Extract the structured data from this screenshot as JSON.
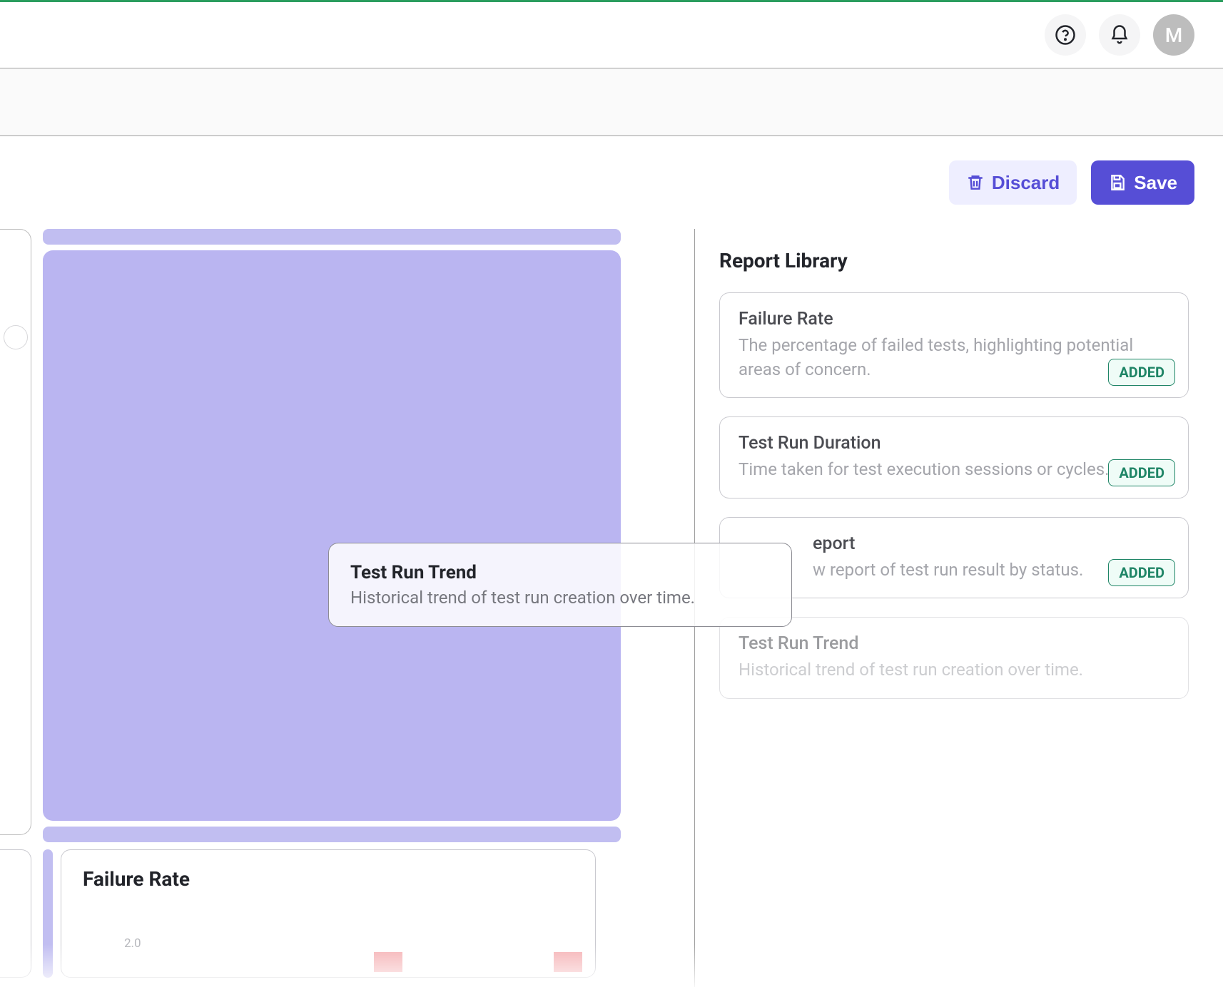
{
  "header": {
    "avatar_initial": "M"
  },
  "actions": {
    "discard_label": "Discard",
    "save_label": "Save"
  },
  "dragging": {
    "title": "Test Run Trend",
    "description": "Historical trend of test run creation over time."
  },
  "failure_card": {
    "title": "Failure Rate",
    "y_tick": "2.0"
  },
  "library": {
    "title": "Report Library",
    "added_label": "ADDED",
    "items": [
      {
        "title": "Failure Rate",
        "description": "The percentage of failed tests, highlighting potential areas of concern.",
        "added": true
      },
      {
        "title": "Test Run Duration",
        "description": "Time taken for test execution sessions or cycles.",
        "added": true
      },
      {
        "title": "eport",
        "description": "w report of test run result by status.",
        "added": true
      },
      {
        "title": "Test Run Trend",
        "description": "Historical trend of test run creation over time.",
        "added": false
      }
    ]
  },
  "chart_data": {
    "type": "bar",
    "title": "Failure Rate",
    "ylim": [
      0,
      2.0
    ],
    "categories": [
      "",
      ""
    ],
    "values": [
      0.5,
      0.5
    ]
  }
}
